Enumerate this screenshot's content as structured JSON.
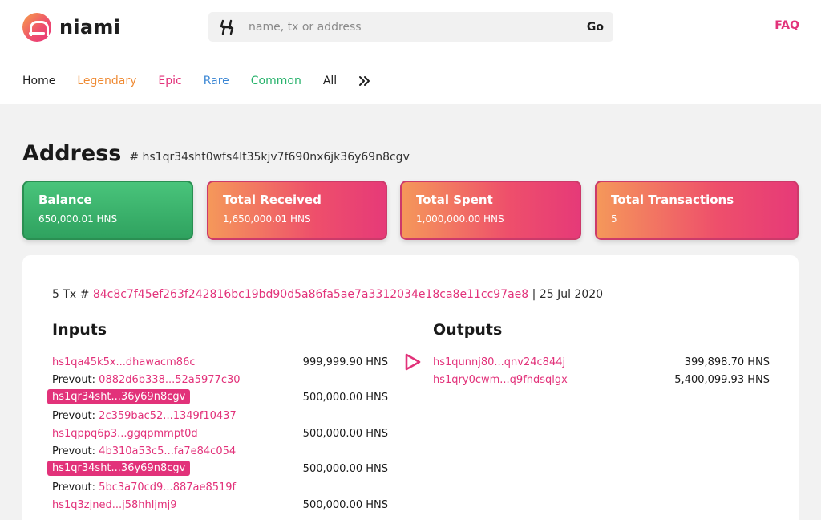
{
  "brand": {
    "name": "niami"
  },
  "search": {
    "placeholder": "name, tx or address",
    "go_label": "Go"
  },
  "faq_label": "FAQ",
  "nav": {
    "home": "Home",
    "legendary": "Legendary",
    "epic": "Epic",
    "rare": "Rare",
    "common": "Common",
    "all": "All"
  },
  "page": {
    "title": "Address",
    "hash_prefix": "#",
    "address": "hs1qr34sht0wfs4lt35kjv7f690nx6jk36y69n8cgv"
  },
  "cards": [
    {
      "title": "Balance",
      "value": "650,000.01 HNS"
    },
    {
      "title": "Total Received",
      "value": "1,650,000.01 HNS"
    },
    {
      "title": "Total Spent",
      "value": "1,000,000.00 HNS"
    },
    {
      "title": "Total Transactions",
      "value": "5"
    }
  ],
  "tx": {
    "count_label": "5 Tx #",
    "hash": "84c8c7f45ef263f242816bc19bd90d5a86fa5ae7a3312034e18ca8e11cc97ae8",
    "separator": "|",
    "date": "25 Jul 2020",
    "inputs_title": "Inputs",
    "outputs_title": "Outputs",
    "prevout_label": "Prevout:",
    "inputs": [
      {
        "address": "hs1qa45k5x...dhawacm86c",
        "amount": "999,999.90 HNS",
        "prevout": "0882d6b338...52a5977c30",
        "highlight": false
      },
      {
        "address": "hs1qr34sht...36y69n8cgv",
        "amount": "500,000.00 HNS",
        "prevout": "2c359bac52...1349f10437",
        "highlight": true
      },
      {
        "address": "hs1qppq6p3...ggqpmmpt0d",
        "amount": "500,000.00 HNS",
        "prevout": "4b310a53c5...fa7e84c054",
        "highlight": false
      },
      {
        "address": "hs1qr34sht...36y69n8cgv",
        "amount": "500,000.00 HNS",
        "prevout": "5bc3a70cd9...887ae8519f",
        "highlight": true
      },
      {
        "address": "hs1q3zjned...j58hhljmj9",
        "amount": "500,000.00 HNS"
      }
    ],
    "outputs": [
      {
        "address": "hs1qunnj80...qnv24c844j",
        "amount": "399,898.70 HNS"
      },
      {
        "address": "hs1qry0cwm...q9fhdsqlgx",
        "amount": "5,400,099.93 HNS"
      }
    ]
  },
  "colors": {
    "accent": "#e2327a",
    "legendary": "#ef8a33",
    "rare": "#3a86d4",
    "common": "#27b26b",
    "balance_green": "#3bb56c"
  }
}
